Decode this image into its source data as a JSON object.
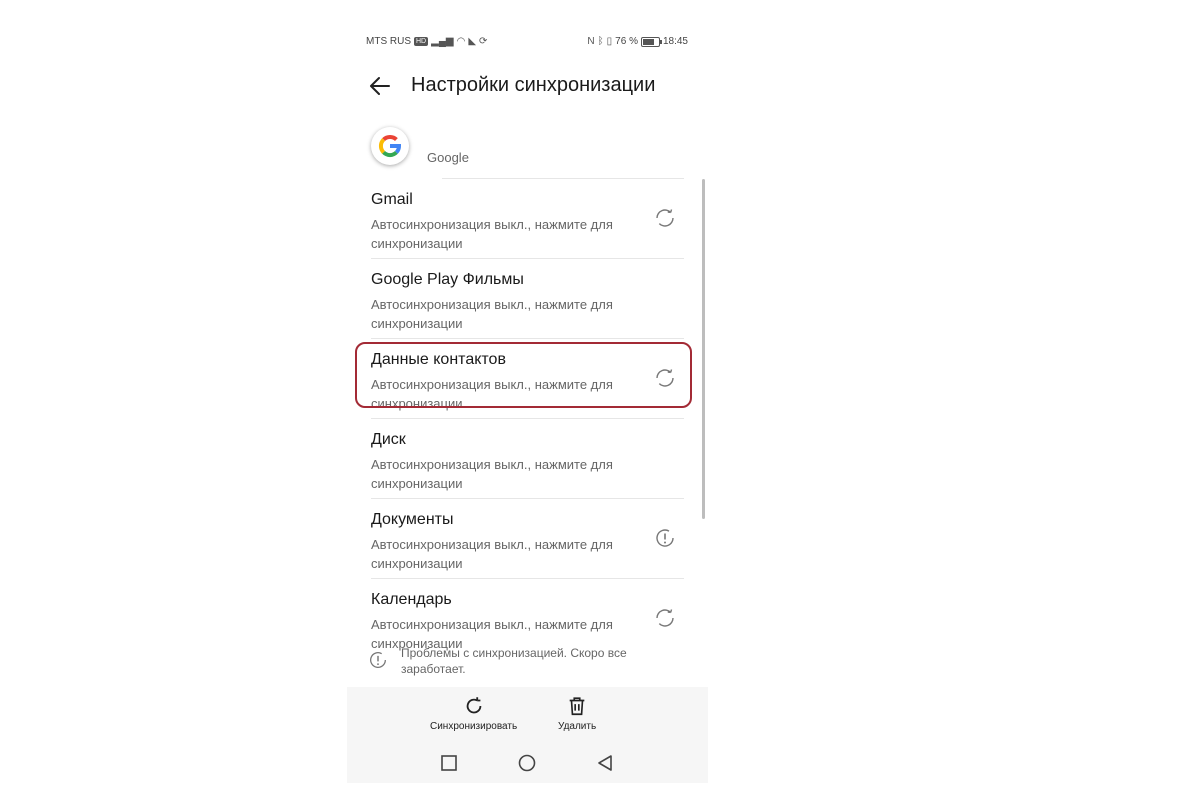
{
  "status_bar": {
    "carrier": "MTS RUS",
    "hd_badge": "HD",
    "battery": "76 %",
    "battery_level": 0.76,
    "time": "18:45"
  },
  "header": {
    "title": "Настройки синхронизации",
    "back_icon": "arrow-left-icon"
  },
  "account": {
    "name": "Google",
    "icon": "google-logo-icon"
  },
  "sync_items": [
    {
      "title": "Gmail",
      "subtitle": "Автосинхронизация выкл., нажмите для синхронизации",
      "status_icon": "sync-icon"
    },
    {
      "title": "Google Play Фильмы",
      "subtitle": "Автосинхронизация выкл., нажмите для синхронизации",
      "status_icon": ""
    },
    {
      "title": "Данные контактов",
      "subtitle": "Автосинхронизация выкл., нажмите для синхронизации",
      "status_icon": "sync-icon",
      "highlighted": true
    },
    {
      "title": "Диск",
      "subtitle": "Автосинхронизация выкл., нажмите для синхронизации",
      "status_icon": ""
    },
    {
      "title": "Документы",
      "subtitle": "Автосинхронизация выкл., нажмите для синхронизации",
      "status_icon": "alert-icon"
    },
    {
      "title": "Календарь",
      "subtitle": "Автосинхронизация выкл., нажмите для синхронизации",
      "status_icon": "sync-icon"
    }
  ],
  "warning": {
    "text": "Проблемы с синхронизацией. Скоро все заработает.",
    "icon": "alert-icon"
  },
  "actions": {
    "sync_label": "Синхронизировать",
    "delete_label": "Удалить"
  },
  "navigation": [
    "square-icon",
    "circle-icon",
    "triangle-back-icon"
  ],
  "colors": {
    "highlight": "#a32a35",
    "google_blue": "#4285f4",
    "google_red": "#ea4335",
    "google_yellow": "#fbbc05",
    "google_green": "#34a853"
  }
}
